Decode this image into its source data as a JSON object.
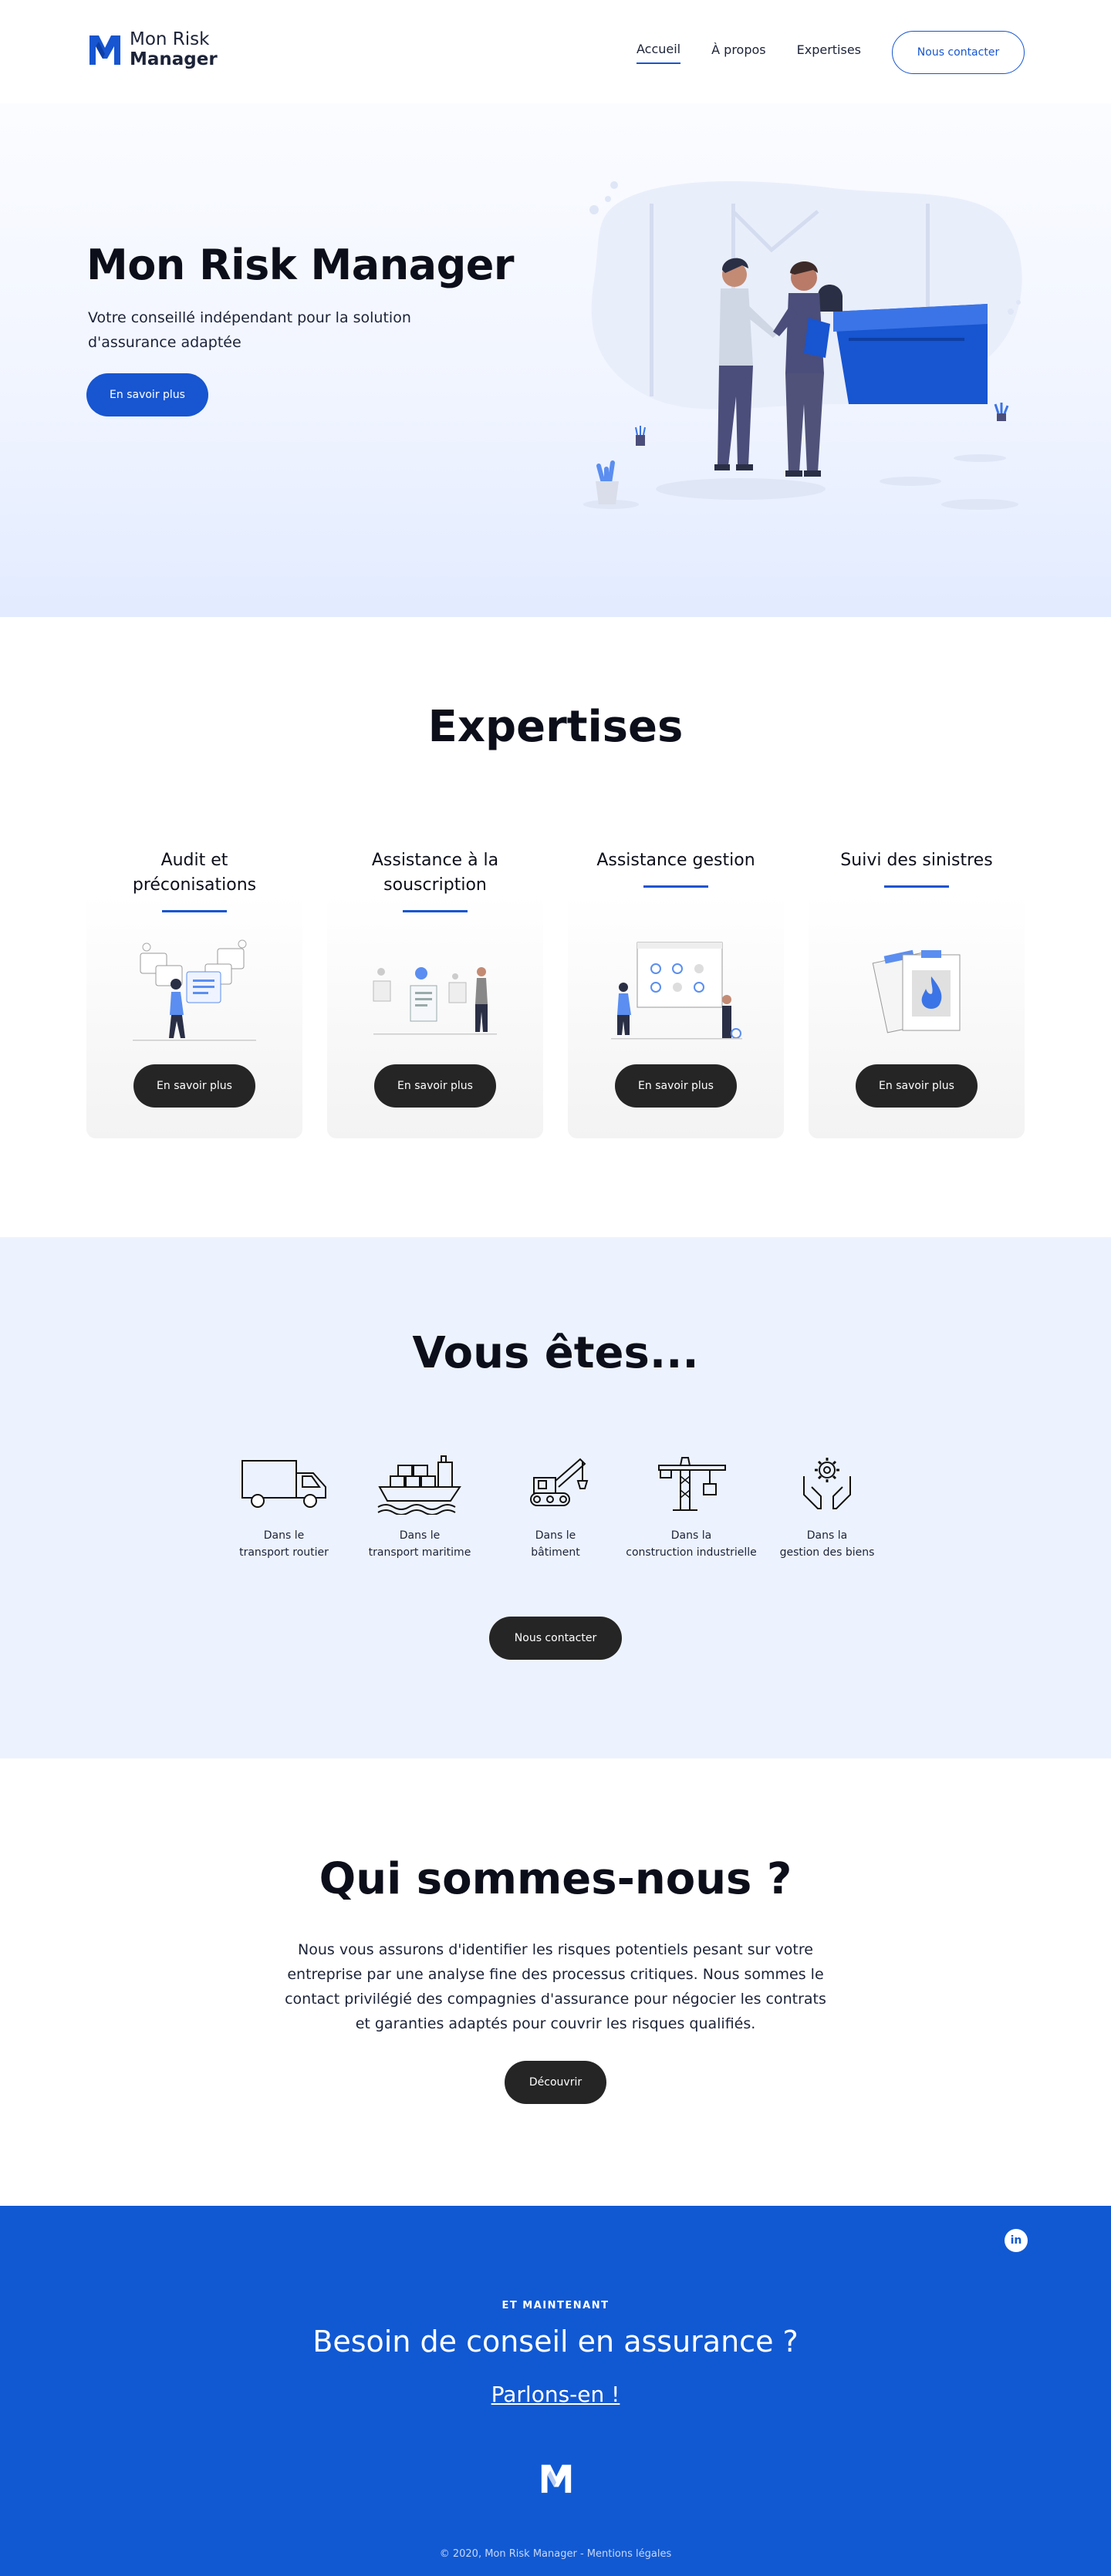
{
  "brand": {
    "name_line1": "Mon Risk",
    "name_line2": "Manager",
    "primary_color": "#1755d1",
    "footer_color": "#1159d3",
    "dark_button_color": "#252525"
  },
  "nav": {
    "items": [
      {
        "label": "Accueil",
        "active": true
      },
      {
        "label": "À propos",
        "active": false
      },
      {
        "label": "Expertises",
        "active": false
      }
    ],
    "cta_label": "Nous contacter"
  },
  "hero": {
    "title": "Mon Risk Manager",
    "subtitle": "Votre conseillé indépendant pour la solution d'assurance adaptée",
    "cta_label": "En savoir plus"
  },
  "expertises": {
    "title": "Expertises",
    "cards": [
      {
        "title": "Audit et préconisations",
        "button": "En savoir plus",
        "icon": "audit-illustration"
      },
      {
        "title": "Assistance à la souscription",
        "button": "En savoir plus",
        "icon": "subscription-illustration"
      },
      {
        "title": "Assistance gestion",
        "button": "En savoir plus",
        "icon": "management-illustration"
      },
      {
        "title": "Suivi des sinistres",
        "button": "En savoir plus",
        "icon": "claims-illustration"
      }
    ]
  },
  "vous_etes": {
    "title": "Vous êtes...",
    "sectors": [
      {
        "line1": "Dans le",
        "line2": "transport routier",
        "icon": "truck-icon"
      },
      {
        "line1": "Dans le",
        "line2": "transport maritime",
        "icon": "ship-icon"
      },
      {
        "line1": "Dans le",
        "line2": "bâtiment",
        "icon": "excavator-icon"
      },
      {
        "line1": "Dans la",
        "line2": "construction industrielle",
        "icon": "crane-icon"
      },
      {
        "line1": "Dans la",
        "line2": "gestion des biens",
        "icon": "hands-gear-icon"
      }
    ],
    "cta_label": "Nous contacter"
  },
  "qui": {
    "title": "Qui sommes-nous ?",
    "text": "Nous vous assurons d'identifier les risques potentiels pesant sur votre entreprise par une analyse fine des processus critiques. Nous sommes le contact privilégié des compagnies d'assurance pour négocier les contrats et garanties adaptés pour couvrir les risques qualifiés.",
    "cta_label": "Découvrir"
  },
  "footer": {
    "social": "in",
    "eyebrow": "ET MAINTENANT",
    "title": "Besoin de conseil en assurance ?",
    "link": "Parlons-en !",
    "copyright": "© 2020, Mon Risk Manager - Mentions légales"
  }
}
